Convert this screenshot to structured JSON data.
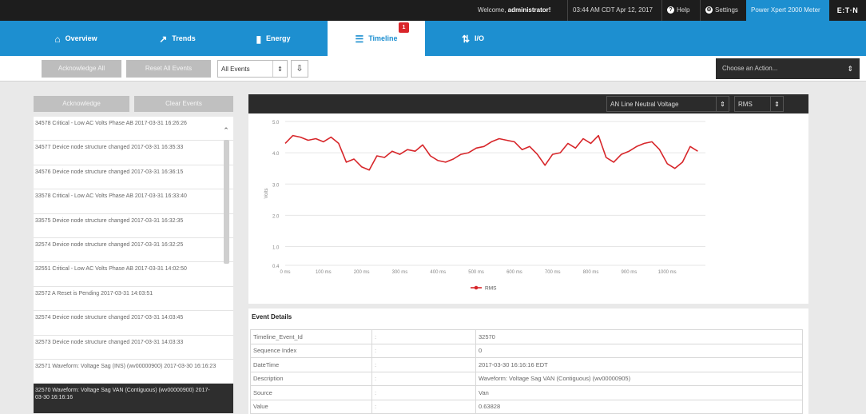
{
  "topbar": {
    "welcome_prefix": "Welcome, ",
    "welcome_user": "administrator!",
    "datetime": "03:44 AM CDT Apr 12, 2017",
    "help_label": "Help",
    "settings_label": "Settings",
    "meter_name": "Power Xpert 2000 Meter",
    "brand": "E:T·N"
  },
  "nav": {
    "overview": "Overview",
    "trends": "Trends",
    "energy": "Energy",
    "timeline": "Timeline",
    "timeline_badge": "1",
    "io": "I/O"
  },
  "toolbar": {
    "acknowledge_all": "Acknowledge All",
    "reset_all": "Reset All Events",
    "filter_value": "All Events",
    "action_placeholder": "Choose an Action..."
  },
  "events": {
    "acknowledge": "Acknowledge",
    "clear_events": "Clear Events",
    "items": [
      "34578 Critical - Low AC Volts Phase AB 2017-03-31 16:26:26",
      "34577 Device node structure changed 2017-03-31 16:35:33",
      "34576 Device node structure changed 2017-03-31 16:36:15",
      "33578 Critical - Low AC Volts Phase AB 2017-03-31 16:33:40",
      "33575 Device node structure changed 2017-03-31 16:32:35",
      "32574 Device node structure changed 2017-03-31 16:32:25",
      "32551 Critical - Low AC Volts Phase AB 2017-03-31 14:02:50",
      "32572 A Reset is Pending 2017-03-31 14:03:51",
      "32574 Device node structure changed 2017-03-31 14:03:45",
      "32573 Device node structure changed 2017-03-31 14:03:33",
      "32571 Waveform: Voltage Sag (INS) (wv00000900) 2017-03-30 16:16:23",
      "32570 Waveform: Voltage Sag VAN (Contiguous) (wv00000900) 2017-03-30 16:16:16"
    ]
  },
  "chart_panel": {
    "measurement": "AN Line Neutral Voltage",
    "unit_select": "RMS"
  },
  "chart_data": {
    "type": "line",
    "ylabel": "Volts",
    "ylim": [
      0.4,
      5.0
    ],
    "y_ticks": [
      "5.0",
      "4.0",
      "3.0",
      "2.0",
      "1.0",
      "0.4"
    ],
    "y_tick_values": [
      5.0,
      4.0,
      3.0,
      2.0,
      1.0,
      0.4
    ],
    "x_ticks": [
      "0 ms",
      "100 ms",
      "200 ms",
      "300 ms",
      "400 ms",
      "500 ms",
      "600 ms",
      "700 ms",
      "800 ms",
      "900 ms",
      "1000 ms"
    ],
    "xlim": [
      0,
      1100
    ],
    "series": [
      {
        "name": "RMS",
        "color": "#d7262a",
        "x": [
          0,
          20,
          40,
          60,
          80,
          100,
          120,
          140,
          160,
          180,
          200,
          220,
          240,
          260,
          280,
          300,
          320,
          340,
          360,
          380,
          400,
          420,
          440,
          460,
          480,
          500,
          520,
          540,
          560,
          580,
          600,
          620,
          640,
          660,
          680,
          700,
          720,
          740,
          760,
          780,
          800,
          820,
          840,
          860,
          880,
          900,
          920,
          940,
          960,
          980,
          1000,
          1020,
          1040,
          1060,
          1080
        ],
        "y": [
          4.3,
          4.55,
          4.5,
          4.4,
          4.45,
          4.35,
          4.5,
          4.3,
          3.7,
          3.8,
          3.55,
          3.45,
          3.9,
          3.85,
          4.05,
          3.95,
          4.1,
          4.05,
          4.25,
          3.9,
          3.75,
          3.7,
          3.8,
          3.95,
          4.0,
          4.15,
          4.2,
          4.35,
          4.45,
          4.4,
          4.35,
          4.1,
          4.2,
          3.95,
          3.6,
          3.95,
          4.0,
          4.3,
          4.15,
          4.45,
          4.3,
          4.55,
          3.85,
          3.7,
          3.95,
          4.05,
          4.2,
          4.3,
          4.35,
          4.1,
          3.65,
          3.5,
          3.7,
          4.2,
          4.05
        ]
      }
    ],
    "legend": "bottom-center",
    "grid": true
  },
  "details": {
    "title": "Event Details",
    "rows": [
      {
        "key": "Timeline_Event_Id",
        "sep": ":",
        "value": "32570"
      },
      {
        "key": "Sequence Index",
        "sep": ":",
        "value": "0"
      },
      {
        "key": "DateTime",
        "sep": ":",
        "value": "2017-03-30 16:16:16 EDT"
      },
      {
        "key": "Description",
        "sep": ":",
        "value": "Waveform: Voltage Sag VAN (Contiguous) (wv00000905)"
      },
      {
        "key": "Source",
        "sep": ":",
        "value": "Van"
      },
      {
        "key": "Value",
        "sep": ":",
        "value": "0.63828"
      }
    ]
  }
}
